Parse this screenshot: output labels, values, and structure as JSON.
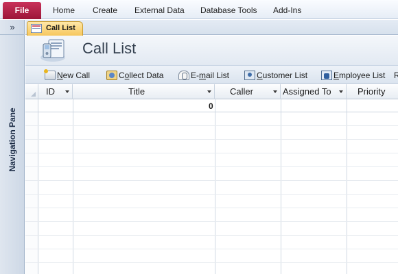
{
  "ribbon": {
    "file_label": "File",
    "tabs": [
      "Home",
      "Create",
      "External Data",
      "Database Tools",
      "Add-Ins"
    ]
  },
  "nav_pane": {
    "toggle_glyph": "»",
    "label": "Navigation Pane"
  },
  "document": {
    "tab_label": "Call List",
    "title": "Call List"
  },
  "commands": {
    "new_call": {
      "pre": "",
      "key": "N",
      "post": "ew Call"
    },
    "collect_data": {
      "pre": "C",
      "key": "o",
      "post": "llect Data"
    },
    "email_list": {
      "pre": "E-",
      "key": "m",
      "post": "ail List"
    },
    "customer_list": {
      "pre": "",
      "key": "C",
      "post": "ustomer List"
    },
    "employee_list": {
      "pre": "",
      "key": "E",
      "post": "mployee List"
    },
    "overflow_glyph": "R"
  },
  "grid": {
    "columns": [
      "ID",
      "Title",
      "Caller",
      "Assigned To",
      "Priority"
    ],
    "first_row": {
      "title_value": "0"
    }
  },
  "colors": {
    "file_tab": "#b0244a",
    "doc_tab": "#f6c75e",
    "nav_pane": "#d6dfea"
  }
}
